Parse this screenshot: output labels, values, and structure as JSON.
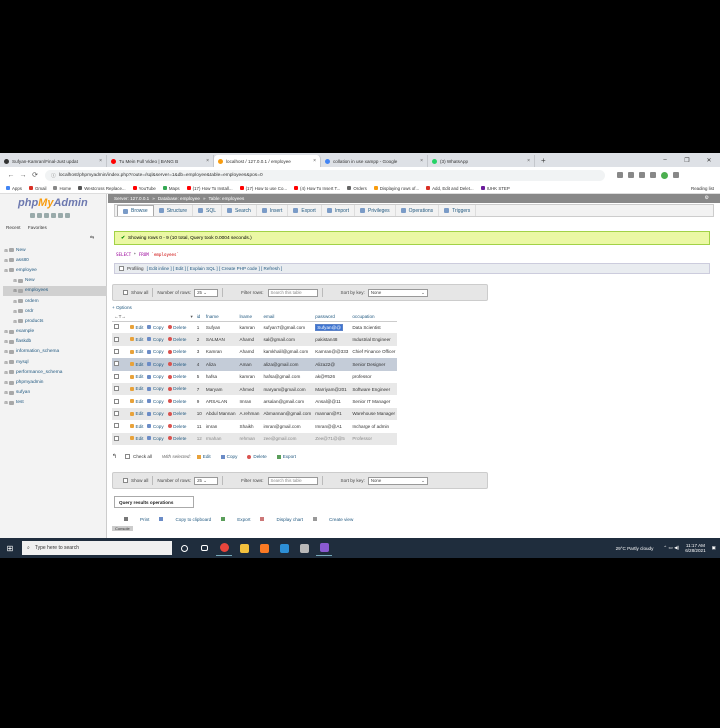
{
  "browser": {
    "tabs": [
      {
        "title": "Sufyan-Kamran/Final-Just updat",
        "color": "#333333",
        "active": false
      },
      {
        "title": "Tu Mein Full Video | BANG B",
        "color": "#ff0000",
        "active": false
      },
      {
        "title": "localhost / 127.0.0.1 / employee",
        "color": "#f89c0e",
        "active": true
      },
      {
        "title": "collation in use xampp - Google",
        "color": "#4285f4",
        "active": false
      },
      {
        "title": "(3) WhatsApp",
        "color": "#25d366",
        "active": false
      }
    ],
    "new_tab": "+",
    "url": "localhost/phpmyadmin/index.php?route=/sql&server=1&db=employee&table=employees&pos=0",
    "bookmarks": [
      {
        "label": "Apps",
        "color": "#4285f4"
      },
      {
        "label": "Gmail",
        "color": "#d93025"
      },
      {
        "label": "Home",
        "color": "#888888"
      },
      {
        "label": "Westcross Replace...",
        "color": "#555555"
      },
      {
        "label": "YouTube",
        "color": "#ff0000"
      },
      {
        "label": "Maps",
        "color": "#34a853"
      },
      {
        "label": "(17) How To Install...",
        "color": "#ff0000"
      },
      {
        "label": "(17) How to use Co...",
        "color": "#ff0000"
      },
      {
        "label": "(4) How To Insert T...",
        "color": "#ff0000"
      },
      {
        "label": "Orders",
        "color": "#666666"
      },
      {
        "label": "Displaying rows of...",
        "color": "#f89c0e"
      },
      {
        "label": "Add, Edit and Delet...",
        "color": "#d93025"
      },
      {
        "label": "IUHK STEP",
        "color": "#6a1b9a"
      }
    ],
    "reading_list": "Reading list"
  },
  "sidebar": {
    "logo": {
      "php": "php",
      "my": "My",
      "admin": "Admin"
    },
    "recent": "Recent",
    "favorites": "Favorites",
    "tree": [
      {
        "label": "New",
        "level": 0,
        "selected": false
      },
      {
        "label": "ass80",
        "level": 0,
        "selected": false
      },
      {
        "label": "employee",
        "level": 0,
        "selected": false
      },
      {
        "label": "New",
        "level": 1,
        "selected": false
      },
      {
        "label": "employees",
        "level": 1,
        "selected": true
      },
      {
        "label": "ordem",
        "level": 1,
        "selected": false
      },
      {
        "label": "ordr",
        "level": 1,
        "selected": false
      },
      {
        "label": "products",
        "level": 1,
        "selected": false
      },
      {
        "label": "example",
        "level": 0,
        "selected": false
      },
      {
        "label": "flaskdb",
        "level": 0,
        "selected": false
      },
      {
        "label": "information_schema",
        "level": 0,
        "selected": false
      },
      {
        "label": "mysql",
        "level": 0,
        "selected": false
      },
      {
        "label": "performance_schema",
        "level": 0,
        "selected": false
      },
      {
        "label": "phpmyadmin",
        "level": 0,
        "selected": false
      },
      {
        "label": "sufyan",
        "level": 0,
        "selected": false
      },
      {
        "label": "test",
        "level": 0,
        "selected": false
      }
    ]
  },
  "breadcrumb": {
    "server": "Server: 127.0.0.1",
    "database": "Database: employee",
    "table": "Table: employees"
  },
  "menu": [
    "Browse",
    "Structure",
    "SQL",
    "Search",
    "Insert",
    "Export",
    "Import",
    "Privileges",
    "Operations",
    "Triggers"
  ],
  "message": "Showing rows 0 - 9 (10 total, Query took 0.0004 seconds.)",
  "sql": {
    "select": "SELECT",
    "star": "*",
    "from": "FROM",
    "table": "`employees`"
  },
  "profiling": {
    "label": "Profiling",
    "links": "[ Edit inline ] [ Edit ] [ Explain SQL ] [ Create PHP code ] [ Refresh ]"
  },
  "navbar": {
    "show_all": "Show all",
    "num_rows_label": "Number of rows:",
    "num_rows": "25",
    "filter_label": "Filter rows:",
    "filter_placeholder": "Search this table",
    "sort_label": "Sort by key:",
    "sort_value": "None"
  },
  "options_link": "+ Options",
  "table": {
    "headers": [
      "id",
      "fname",
      "lname",
      "email",
      "password",
      "occupation"
    ],
    "edit": "Edit",
    "copy": "Copy",
    "delete": "Delete",
    "rows": [
      [
        "1",
        "Sufyan",
        "kamran",
        "sufyan7@gmail.com",
        "Sufyan@@",
        "Data Scientist"
      ],
      [
        "2",
        "SALMAN",
        "Ahamd",
        "sal@gmail.com",
        "pakistan48",
        "Industrial Engineer"
      ],
      [
        "3",
        "Kamran",
        "Ahamd",
        "kamkhalil@gmail.com",
        "Kamran@@333",
        "Chief Finance Officer"
      ],
      [
        "4",
        "Aliza",
        "Aman",
        "aliza@gmail.com",
        "Aliza22@",
        "Senior Designer"
      ],
      [
        "5",
        "hafsa",
        "kamran",
        "hafsa@gmail.com",
        "ak@#526",
        "professor"
      ],
      [
        "7",
        "Maryam",
        "Ahmed",
        "maryam@gmail.com",
        "Marriyam@201",
        "Software Engineer"
      ],
      [
        "9",
        "ARSALAN",
        "Imran",
        "arsalan@gmail.com",
        "Ansal@@11",
        "Senior IT Manager"
      ],
      [
        "10",
        "Abdul Mannan",
        "A.rehman",
        "Abmannan@gmail.com",
        "mannan@#1",
        "Warehouse Manager"
      ],
      [
        "11",
        "imran",
        "Shaikh",
        "imran@gmail.com",
        "Imran@@A1",
        "Incharge of admin"
      ],
      [
        "12",
        "rmahan",
        "rehman",
        "zee@gmail.com",
        "Zee@71@@5",
        "Professor"
      ]
    ]
  },
  "with_selected": {
    "check_all": "Check all",
    "label": "With selected:",
    "edit": "Edit",
    "copy": "Copy",
    "delete": "Delete",
    "export": "Export"
  },
  "query_ops": {
    "title": "Query results operations",
    "print": "Print",
    "copy_clipboard": "Copy to clipboard",
    "export": "Export",
    "display_chart": "Display chart",
    "create_view": "Create view",
    "console": "Console"
  },
  "taskbar": {
    "search_placeholder": "Type here to search",
    "weather": "29°C  Partly cloudy",
    "time": "11:17 AM",
    "date": "6/28/2021"
  }
}
